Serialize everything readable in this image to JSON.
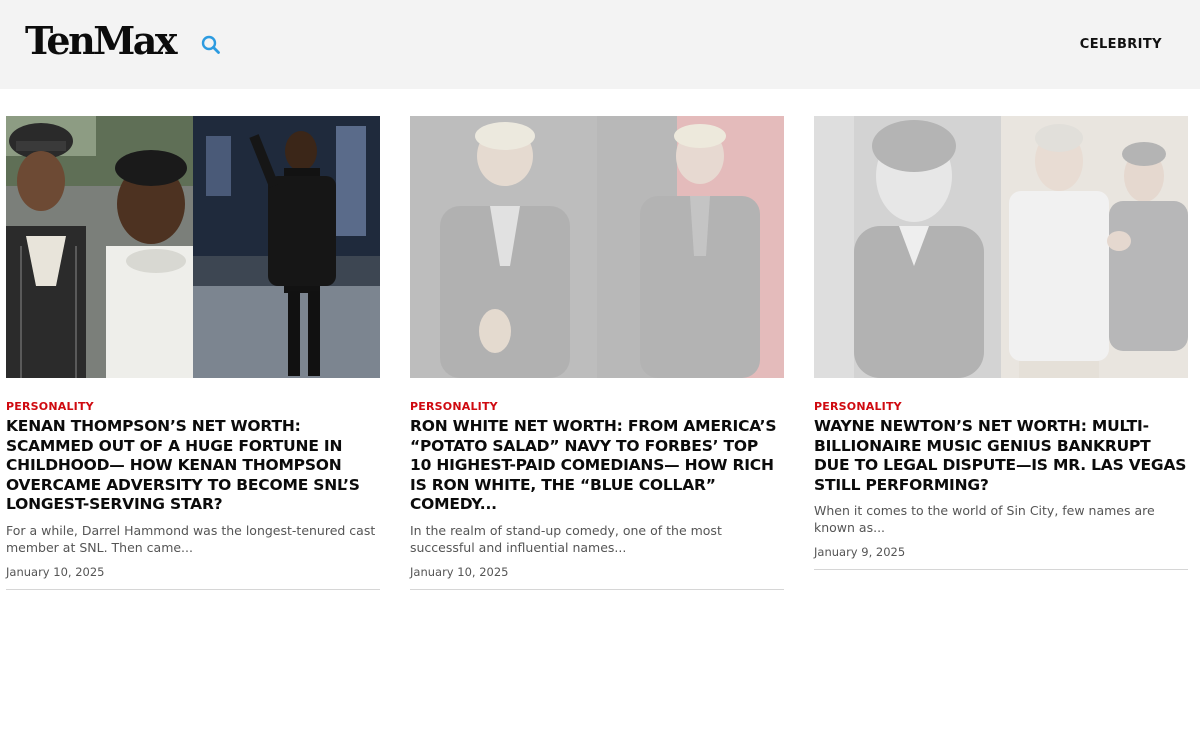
{
  "brand": {
    "logo_text": "TenMax"
  },
  "header": {
    "nav": [
      {
        "label": "CELEBRITY"
      }
    ],
    "search_icon": "search-icon",
    "accent_color": "#2c9be0"
  },
  "articles": [
    {
      "category": "PERSONALITY",
      "title": "KENAN THOMPSON’S NET WORTH: SCAMMED OUT OF A HUGE FORTUNE IN CHILDHOOD— HOW KENAN THOMPSON OVERCAME ADVERSITY TO BECOME SNL’S LONGEST-SERVING STAR?",
      "excerpt": "For a while, Darrel Hammond was the longest-tenured cast member at SNL. Then came...",
      "date": "January 10, 2025"
    },
    {
      "category": "PERSONALITY",
      "title": "RON WHITE NET WORTH: FROM AMERICA’S “POTATO SALAD” NAVY TO FORBES’ TOP 10 HIGHEST-PAID COMEDIANS— HOW RICH IS RON WHITE, THE “BLUE COLLAR” COMEDY...",
      "excerpt": "In the realm of stand-up comedy, one of the most successful and influential names...",
      "date": "January 10, 2025"
    },
    {
      "category": "PERSONALITY",
      "title": "WAYNE NEWTON’S NET WORTH: MULTI-BILLIONAIRE MUSIC GENIUS BANKRUPT DUE TO LEGAL DISPUTE—IS MR. LAS VEGAS STILL PERFORMING?",
      "excerpt": "When it comes to the world of Sin City, few names are known as...",
      "date": "January 9, 2025"
    }
  ],
  "colors": {
    "category": "#cf0a10",
    "header_bg": "#f3f3f3"
  }
}
